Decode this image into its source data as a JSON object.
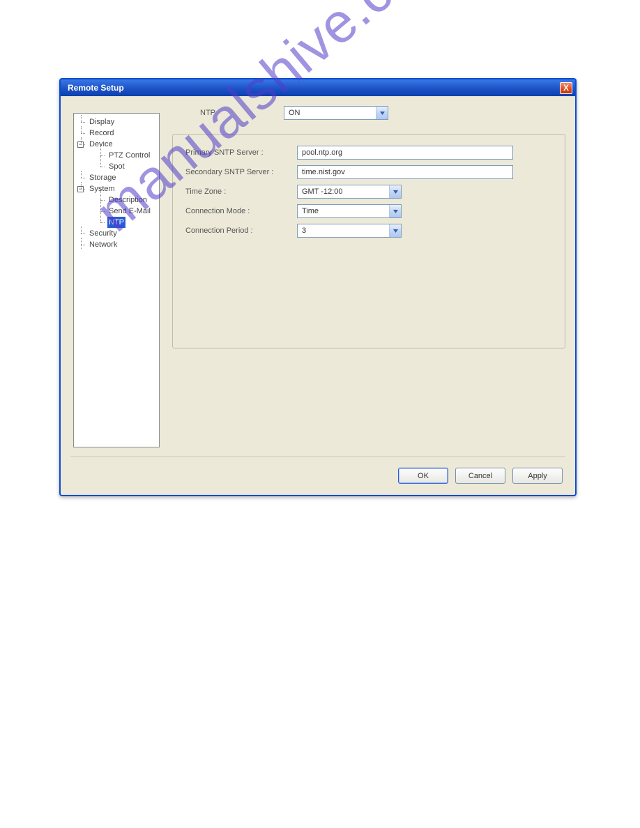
{
  "watermark": "manualshive.com",
  "dialog": {
    "title": "Remote Setup",
    "close_glyph": "X"
  },
  "tree": {
    "display": "Display",
    "record": "Record",
    "device": "Device",
    "ptz": "PTZ Control",
    "spot": "Spot",
    "storage": "Storage",
    "system": "System",
    "desc": "Description",
    "sendemail": "Send E-Mail",
    "ntp": "NTP",
    "security": "Security",
    "network": "Network",
    "expand_minus": "−"
  },
  "form": {
    "ntp_label": "NTP",
    "ntp_value": "ON",
    "primary_label": "Primary SNTP Server :",
    "primary_value": "pool.ntp.org",
    "secondary_label": "Secondary SNTP Server :",
    "secondary_value": "time.nist.gov",
    "tz_label": "Time Zone :",
    "tz_value": "GMT -12:00",
    "mode_label": "Connection Mode :",
    "mode_value": "Time",
    "period_label": "Connection Period :",
    "period_value": "3"
  },
  "buttons": {
    "ok": "OK",
    "cancel": "Cancel",
    "apply": "Apply"
  }
}
